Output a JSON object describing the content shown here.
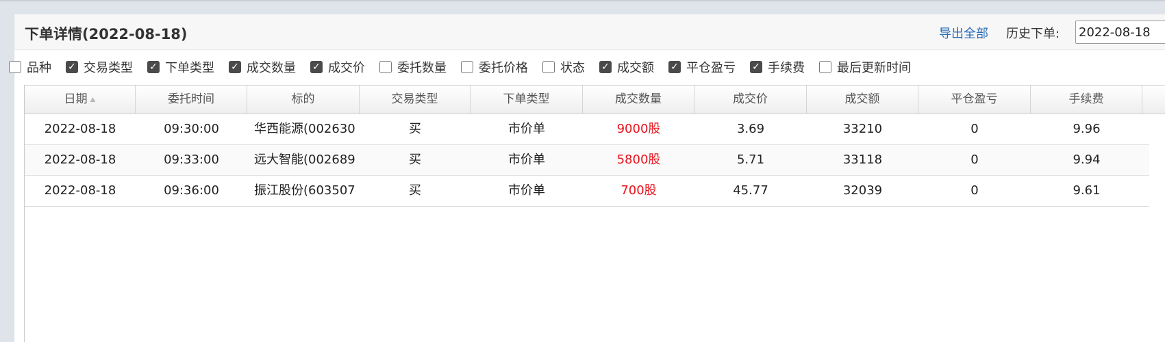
{
  "panel": {
    "title": "下单详情(2022-08-18)",
    "export_label": "导出全部",
    "history_label": "历史下单:",
    "history_date": "2022-08-18"
  },
  "column_toggles": [
    {
      "label": "品种",
      "checked": false
    },
    {
      "label": "交易类型",
      "checked": true
    },
    {
      "label": "下单类型",
      "checked": true
    },
    {
      "label": "成交数量",
      "checked": true
    },
    {
      "label": "成交价",
      "checked": true
    },
    {
      "label": "委托数量",
      "checked": false
    },
    {
      "label": "委托价格",
      "checked": false
    },
    {
      "label": "状态",
      "checked": false
    },
    {
      "label": "成交额",
      "checked": true
    },
    {
      "label": "平仓盈亏",
      "checked": true
    },
    {
      "label": "手续费",
      "checked": true
    },
    {
      "label": "最后更新时间",
      "checked": false
    }
  ],
  "table": {
    "columns": [
      "日期",
      "委托时间",
      "标的",
      "交易类型",
      "下单类型",
      "成交数量",
      "成交价",
      "成交额",
      "平仓盈亏",
      "手续费"
    ],
    "sort_icon": "sort-updown-icon",
    "quantity_color": "#e8121c",
    "rows": [
      [
        "2022-08-18",
        "09:30:00",
        "华西能源(002630",
        "买",
        "市价单",
        "9000股",
        "3.69",
        "33210",
        "0",
        "9.96"
      ],
      [
        "2022-08-18",
        "09:33:00",
        "远大智能(002689",
        "买",
        "市价单",
        "5800股",
        "5.71",
        "33118",
        "0",
        "9.94"
      ],
      [
        "2022-08-18",
        "09:36:00",
        "振江股份(603507",
        "买",
        "市价单",
        "700股",
        "45.77",
        "32039",
        "0",
        "9.61"
      ]
    ]
  }
}
